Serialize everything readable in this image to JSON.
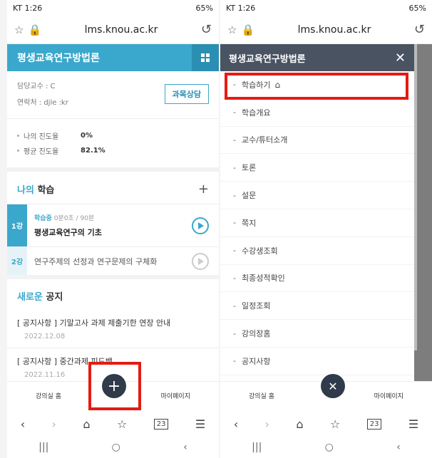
{
  "status": {
    "carrier_time": "KT 1:26",
    "battery": "65%"
  },
  "browser": {
    "url": "lms.knou.ac.kr",
    "tabs_count": "23"
  },
  "course": {
    "title": "평생교육연구방법론"
  },
  "professor": {
    "label": "담당교수 : C",
    "contact": "연락처 : djle                   :kr",
    "consult_button": "과목상담"
  },
  "progress": {
    "items": [
      {
        "label": "나의 진도율",
        "value": "0%"
      },
      {
        "label": "평균 진도율",
        "value": "82.1%"
      }
    ]
  },
  "my_study": {
    "title_accent": "나의",
    "title_rest": " 학습",
    "plus": "+"
  },
  "lessons": [
    {
      "num": "1강",
      "status_label": "학습중",
      "status_detail": " 0분0초 / 90분",
      "title": "평생교육연구의 기초"
    },
    {
      "num": "2강",
      "title": "연구주제의 선정과 연구문제의 구체화"
    }
  ],
  "notices": {
    "title_accent": "새로운",
    "title_rest": " 공지",
    "items": [
      {
        "title": "[ 공지사항 ] 기말고사 과제 제출기한 연장 안내",
        "date": "2022.12.08"
      },
      {
        "title": "[ 공지사항 ] 중간과제 피드백",
        "date": "2022.11.16"
      }
    ]
  },
  "bottom_tabs": {
    "home": "강의실 홈",
    "mypage": "마이페이지"
  },
  "menu": {
    "title": "평생교육연구방법론",
    "items": [
      "학습하기",
      "학습개요",
      "교수/튜터소개",
      "토론",
      "설문",
      "쪽지",
      "수강생조회",
      "최종성적확인",
      "일정조회",
      "강의장홈",
      "공지사항"
    ]
  },
  "colors": {
    "accent": "#3aa7cc",
    "menu_header": "#4a5362",
    "highlight": "#e41b13",
    "fab": "#2f3a4a"
  }
}
